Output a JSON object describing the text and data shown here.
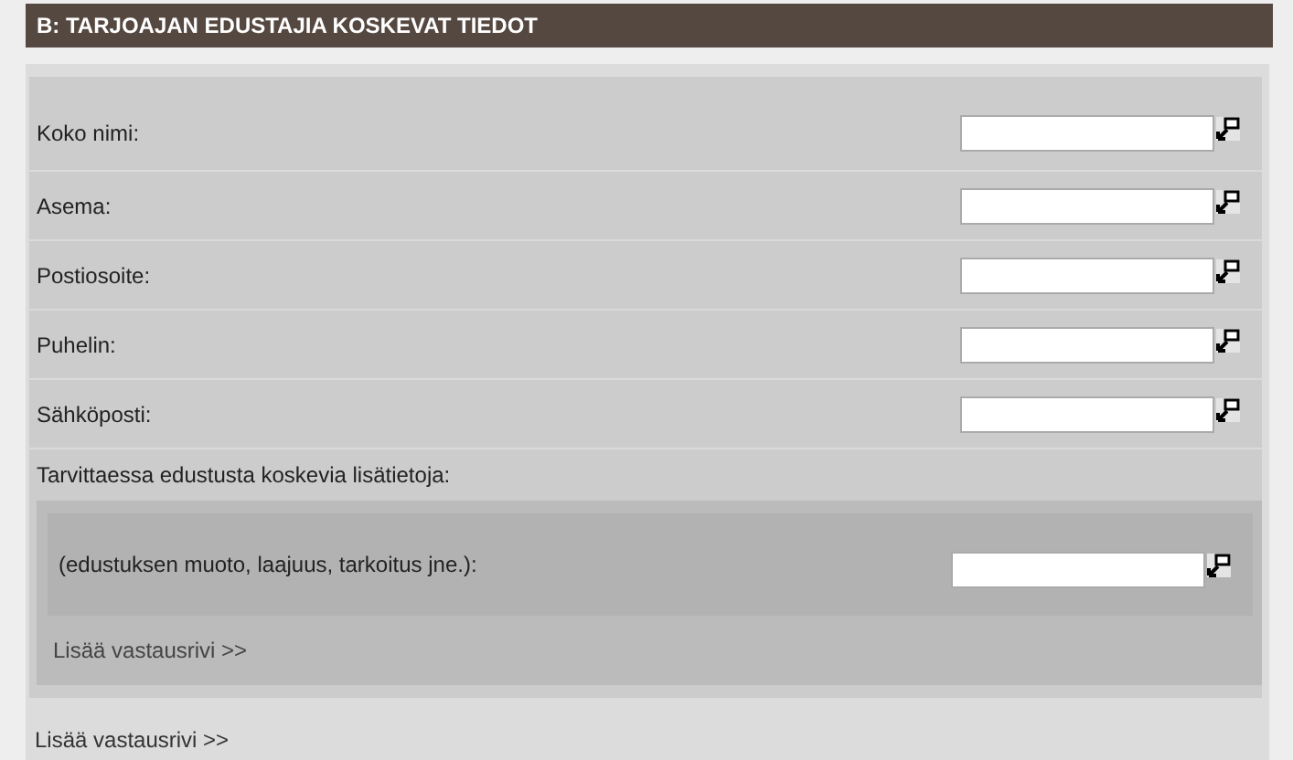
{
  "section": {
    "title": "B: TARJOAJAN EDUSTAJIA KOSKEVAT TIEDOT"
  },
  "fields": [
    {
      "label": "Koko nimi:"
    },
    {
      "label": "Asema:"
    },
    {
      "label": "Postiosoite:"
    },
    {
      "label": "Puhelin:"
    },
    {
      "label": "Sähköposti:"
    }
  ],
  "subsection": {
    "label": "Tarvittaessa edustusta koskevia lisätietoja:",
    "fields": [
      {
        "label": "(edustuksen muoto, laajuus, tarkoitus jne.):"
      }
    ],
    "add_link": "Lisää vastausrivi >>"
  },
  "add_link": "Lisää vastausrivi >>"
}
